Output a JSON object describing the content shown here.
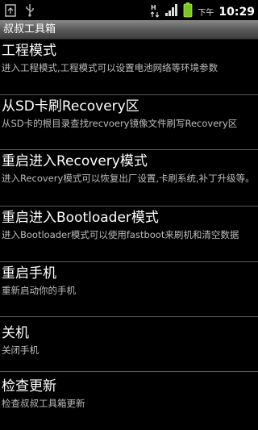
{
  "status_bar": {
    "icons": [
      "usb-debug-icon",
      "usb-icon",
      "data-sync-icon",
      "signal-icon",
      "battery-icon"
    ],
    "ampm": "下午",
    "time": "10:29"
  },
  "app": {
    "title": "叔叔工具箱"
  },
  "menu": {
    "items": [
      {
        "title": "工程模式",
        "desc": "进入工程模式,工程模式可以设置电池网络等环境参数"
      },
      {
        "title": "从SD卡刷Recovery区",
        "desc": "从SD卡的根目录查找recvoery镜像文件刷写Recovery区"
      },
      {
        "title": "重启进入Recovery模式",
        "desc": "进入Recovery模式可以恢复出厂设置,卡刷系统,补丁升级等。"
      },
      {
        "title": "重启进入Bootloader模式",
        "desc": "进入Bootloader模式可以使用fastboot来刷机和清空数据"
      },
      {
        "title": "重启手机",
        "desc": "重新启动你的手机"
      },
      {
        "title": "关机",
        "desc": "关闭手机"
      },
      {
        "title": "检查更新",
        "desc": "检查叔叔工具箱更新"
      }
    ]
  }
}
